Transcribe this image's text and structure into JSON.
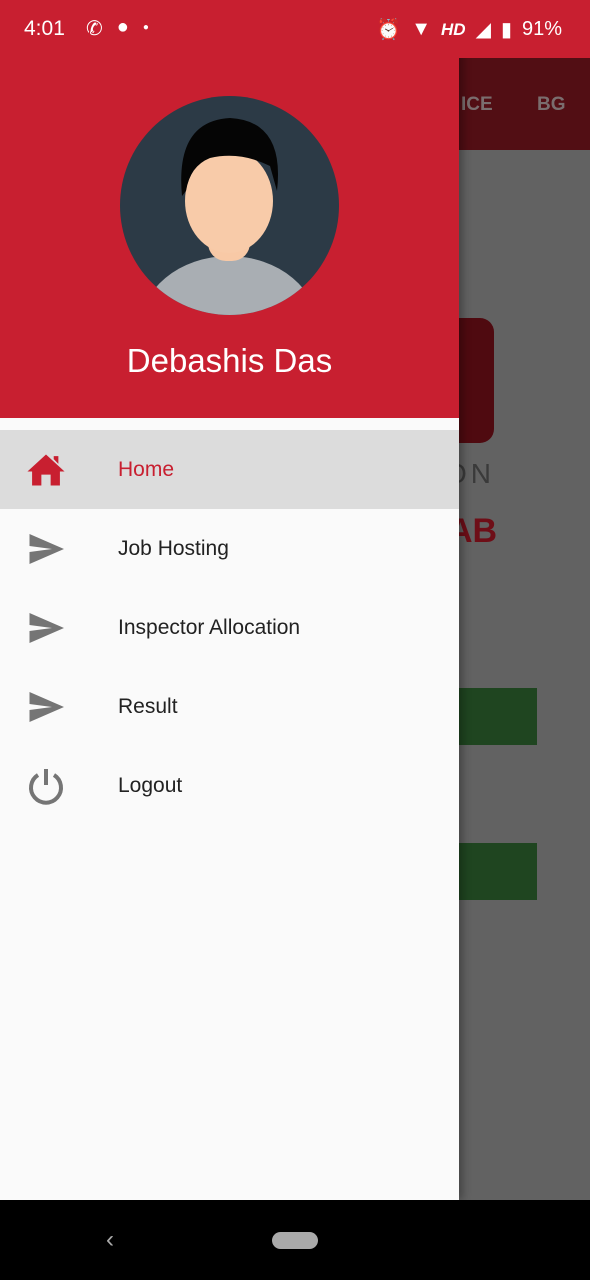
{
  "status_bar": {
    "time": "4:01",
    "battery": "91%",
    "network": "HD",
    "icons": [
      "whatsapp-icon",
      "notification-app-icon",
      "dot-icon",
      "alarm-icon",
      "wifi-icon",
      "signal-icon",
      "battery-icon"
    ]
  },
  "background_app": {
    "tabs": [
      "ICE",
      "BG"
    ],
    "logo_text": "ON",
    "brand_text": "AB"
  },
  "drawer": {
    "user_name": "Debashis Das",
    "items": [
      {
        "label": "Home",
        "icon": "home-icon",
        "active": true
      },
      {
        "label": "Job Hosting",
        "icon": "send-icon"
      },
      {
        "label": "Inspector Allocation",
        "icon": "send-icon"
      },
      {
        "label": "Result",
        "icon": "send-icon"
      },
      {
        "label": "Logout",
        "icon": "power-icon"
      }
    ]
  },
  "colors": {
    "primary": "#c81f30",
    "active_bg": "#dcdcdc",
    "icon_grey": "#757575"
  }
}
